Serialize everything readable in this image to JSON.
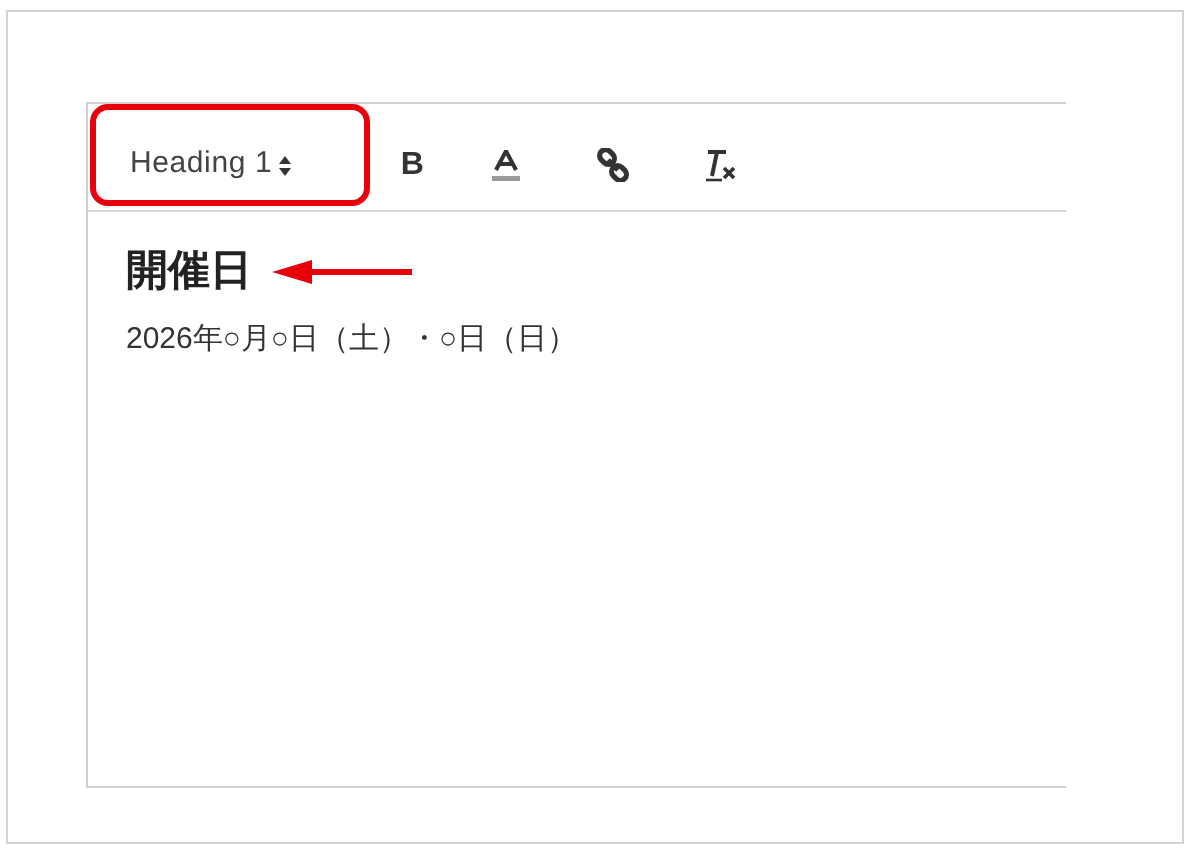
{
  "toolbar": {
    "block_format": {
      "label": "Heading 1",
      "highlighted": true
    },
    "buttons": [
      {
        "kind": "bold",
        "label": "B"
      },
      {
        "kind": "color"
      },
      {
        "kind": "link"
      },
      {
        "kind": "clear"
      }
    ]
  },
  "content": [
    {
      "kind": "heading",
      "text": "開催日",
      "arrow": true
    },
    {
      "kind": "paragraph",
      "text": "2026年○月○日（土）・○日（日）",
      "arrow": false
    }
  ]
}
